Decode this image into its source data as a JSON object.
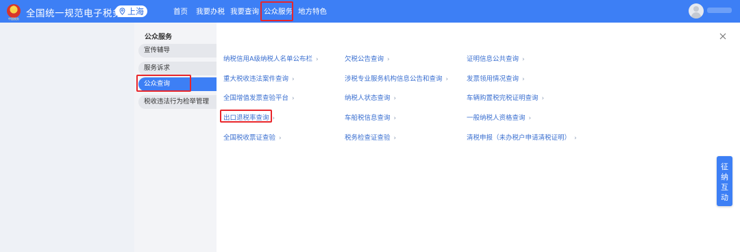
{
  "header": {
    "brand": "全国统一规范电子税务局",
    "emblem_caption": "中国税务",
    "region": "上海",
    "nav": [
      "首页",
      "我要办税",
      "我要查询",
      "公众服务",
      "地方特色"
    ]
  },
  "sidebar": {
    "title": "公众服务",
    "items": [
      {
        "label": "宣传辅导"
      },
      {
        "label": "服务诉求"
      },
      {
        "label": "公众查询"
      },
      {
        "label": "税收违法行为检举管理"
      }
    ]
  },
  "links": [
    [
      "纳税信用A级纳税人名单公布栏",
      "欠税公告查询",
      "证明信息公共查询"
    ],
    [
      "重大税收违法案件查询",
      "涉税专业服务机构信息公告和查询",
      "发票领用情况查询"
    ],
    [
      "全国增值发票查验平台",
      "纳税人状态查询",
      "车辆购置税完税证明查询"
    ],
    [
      "出口退税率查询",
      "车船税信息查询",
      "一般纳税人资格查询"
    ],
    [
      "全国税收票证查验",
      "税务检查证查验",
      "清税申报（未办税户申请清税证明）"
    ]
  ],
  "link_arrow": "›",
  "float_button": [
    "征",
    "纳",
    "互",
    "动"
  ],
  "colors": {
    "header_bg": "#3d7ff5",
    "link": "#3a6fd0",
    "highlight_outline": "#e8252a"
  }
}
